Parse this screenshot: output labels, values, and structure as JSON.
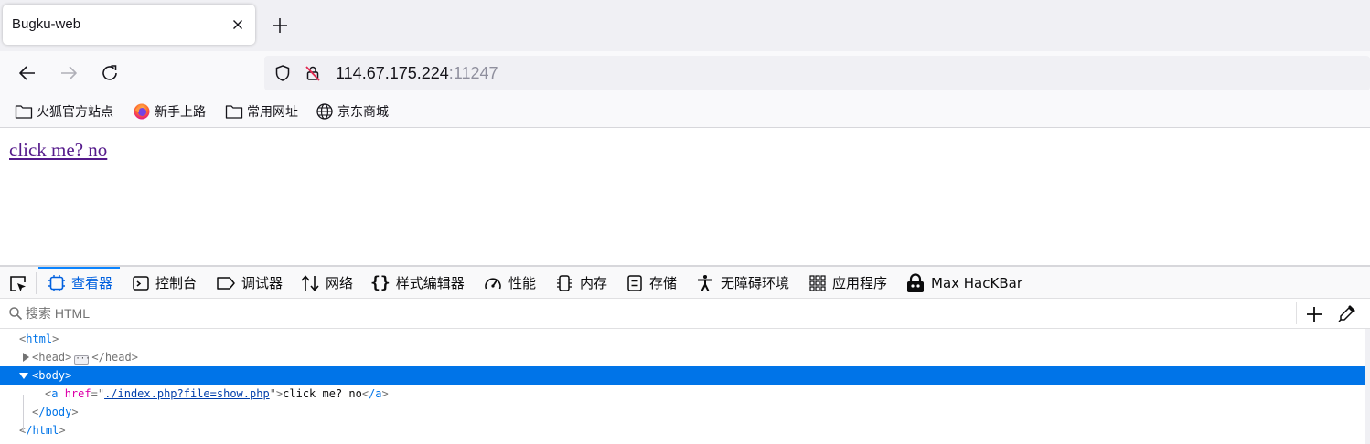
{
  "tab": {
    "title": "Bugku-web"
  },
  "urlbar": {
    "host": "114.67.175.224",
    "port": ":11247"
  },
  "bookmarks": [
    {
      "label": "火狐官方站点",
      "icon": "folder-icon"
    },
    {
      "label": "新手上路",
      "icon": "firefox-icon"
    },
    {
      "label": "常用网址",
      "icon": "folder-icon"
    },
    {
      "label": "京东商城",
      "icon": "globe-icon"
    }
  ],
  "page": {
    "link_text": "click me? no"
  },
  "devtools": {
    "tabs": [
      {
        "label": "查看器",
        "icon": "inspector-icon"
      },
      {
        "label": "控制台",
        "icon": "console-icon"
      },
      {
        "label": "调试器",
        "icon": "debugger-icon"
      },
      {
        "label": "网络",
        "icon": "network-icon"
      },
      {
        "label": "样式编辑器",
        "icon": "style-editor-icon"
      },
      {
        "label": "性能",
        "icon": "performance-icon"
      },
      {
        "label": "内存",
        "icon": "memory-icon"
      },
      {
        "label": "存储",
        "icon": "storage-icon"
      },
      {
        "label": "无障碍环境",
        "icon": "accessibility-icon"
      },
      {
        "label": "应用程序",
        "icon": "application-icon"
      },
      {
        "label": "Max HacKBar",
        "icon": "hackbar-icon"
      }
    ],
    "selected_tab": "查看器",
    "search_placeholder": "搜索 HTML",
    "tree": {
      "html_open": "html",
      "head_tag": "head",
      "head_close": "/head",
      "body_tag": "body",
      "a_tag": "a",
      "a_attr": "href",
      "a_value": "./index.php?file=show.php",
      "a_text": "click me? no",
      "a_close": "/a",
      "body_close": "/body",
      "html_close": "/html"
    }
  },
  "colors": {
    "accent": "#0a84ff",
    "selected_row": "#0074e8",
    "visited_link": "#551a8b"
  }
}
